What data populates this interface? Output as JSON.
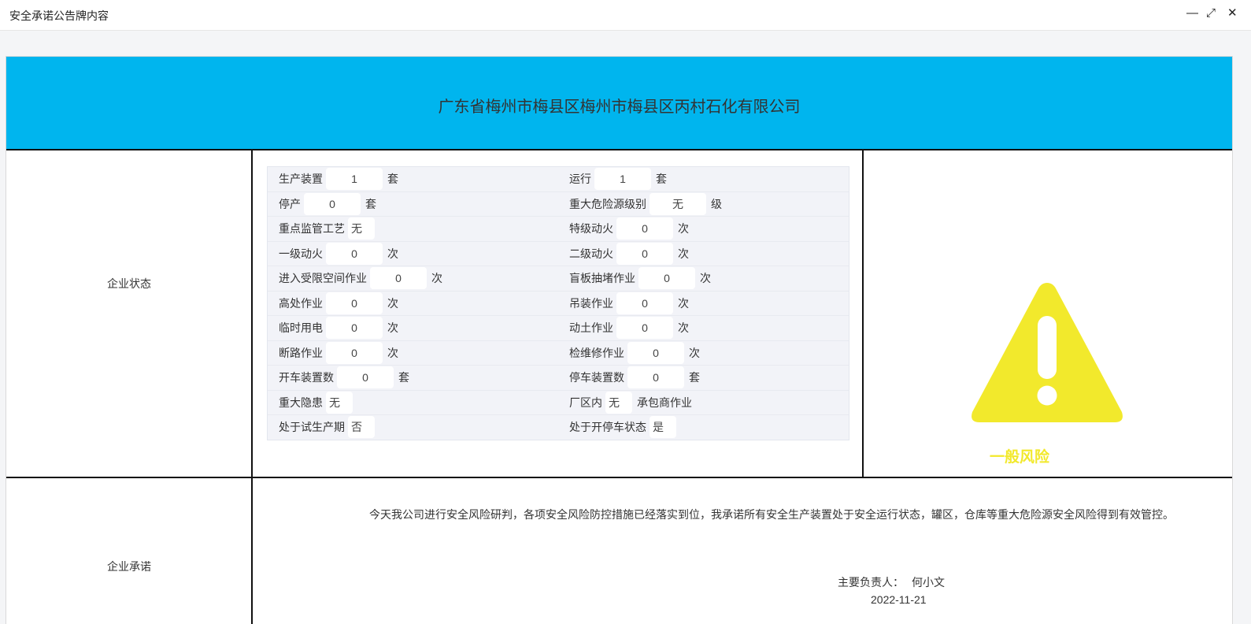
{
  "window": {
    "title": "安全承诺公告牌内容",
    "minimize_icon": "—",
    "maximize_icon": "⤢",
    "close_icon": "✕"
  },
  "banner": {
    "company_name": "广东省梅州市梅县区梅州市梅县区丙村石化有限公司",
    "color": "#00b5ee"
  },
  "status_section": {
    "label": "企业状态",
    "rows": [
      {
        "left": {
          "label": "生产装置",
          "value": "1",
          "unit": "套"
        },
        "right": {
          "label": "运行",
          "value": "1",
          "unit": "套"
        }
      },
      {
        "left": {
          "label": "停产",
          "value": "0",
          "unit": "套"
        },
        "right": {
          "label": "重大危险源级别",
          "value": "无",
          "unit": "级"
        }
      },
      {
        "left": {
          "label": "重点监管工艺",
          "value": "无",
          "unit": ""
        },
        "right": {
          "label": "特级动火",
          "value": "0",
          "unit": "次"
        }
      },
      {
        "left": {
          "label": "一级动火",
          "value": "0",
          "unit": "次"
        },
        "right": {
          "label": "二级动火",
          "value": "0",
          "unit": "次"
        }
      },
      {
        "left": {
          "label": "进入受限空间作业",
          "value": "0",
          "unit": "次"
        },
        "right": {
          "label": "盲板抽堵作业",
          "value": "0",
          "unit": "次"
        }
      },
      {
        "left": {
          "label": "高处作业",
          "value": "0",
          "unit": "次"
        },
        "right": {
          "label": "吊装作业",
          "value": "0",
          "unit": "次"
        }
      },
      {
        "left": {
          "label": "临时用电",
          "value": "0",
          "unit": "次"
        },
        "right": {
          "label": "动土作业",
          "value": "0",
          "unit": "次"
        }
      },
      {
        "left": {
          "label": "断路作业",
          "value": "0",
          "unit": "次"
        },
        "right": {
          "label": "检维修作业",
          "value": "0",
          "unit": "次"
        }
      },
      {
        "left": {
          "label": "开车装置数",
          "value": "0",
          "unit": "套"
        },
        "right": {
          "label": "停车装置数",
          "value": "0",
          "unit": "套"
        }
      },
      {
        "left": {
          "label": "重大隐患",
          "value": "无",
          "unit": ""
        },
        "right": {
          "label": "厂区内",
          "value": "无",
          "unit": "承包商作业"
        }
      },
      {
        "left": {
          "label": "处于试生产期",
          "value": "否",
          "unit": ""
        },
        "right": {
          "label": "处于开停车状态",
          "value": "是",
          "unit": ""
        }
      }
    ]
  },
  "risk": {
    "icon": "warning-triangle-icon",
    "level_text": "一般风险",
    "color": "#f2e92c"
  },
  "commitment_section": {
    "label": "企业承诺",
    "text": "今天我公司进行安全风险研判，各项安全风险防控措施已经落实到位，我承诺所有安全生产装置处于安全运行状态，罐区，仓库等重大危险源安全风险得到有效管控。",
    "owner_label": "主要负责人：",
    "owner_name": "何小文",
    "date": "2022-11-21"
  }
}
